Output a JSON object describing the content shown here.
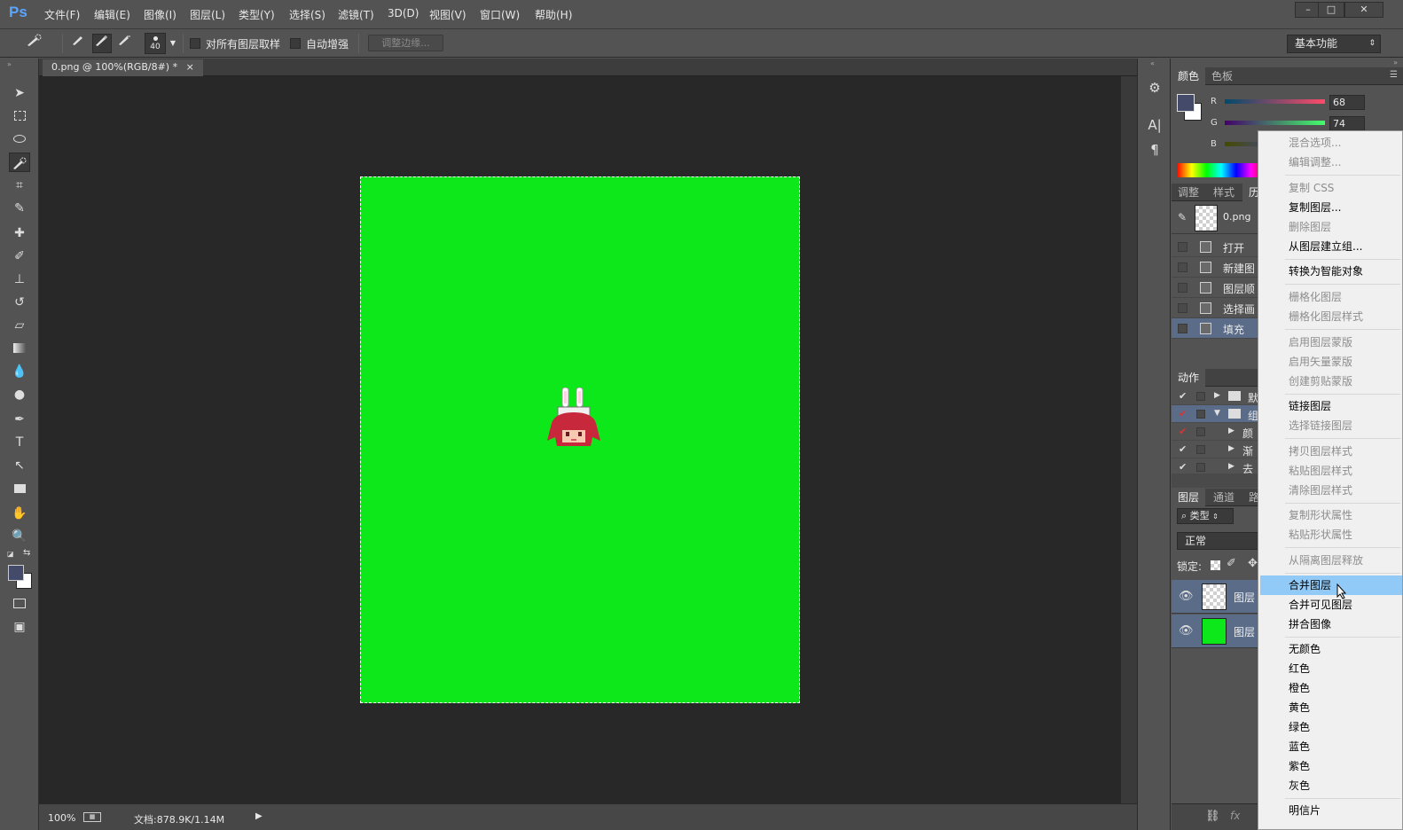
{
  "app": {
    "logo": "Ps"
  },
  "menu": [
    {
      "label": "文件(F)"
    },
    {
      "label": "编辑(E)"
    },
    {
      "label": "图像(I)"
    },
    {
      "label": "图层(L)"
    },
    {
      "label": "类型(Y)"
    },
    {
      "label": "选择(S)"
    },
    {
      "label": "滤镜(T)"
    },
    {
      "label": "3D(D)"
    },
    {
      "label": "视图(V)"
    },
    {
      "label": "窗口(W)"
    },
    {
      "label": "帮助(H)"
    }
  ],
  "window_controls": {
    "minimize": "–",
    "restore": "□",
    "close": "✕"
  },
  "options": {
    "brush_size": "40",
    "sample_all_layers": "对所有图层取样",
    "auto_enhance": "自动增强",
    "refine_edge": "调整边缘...",
    "workspace": "基本功能"
  },
  "document": {
    "tab_title": "0.png @ 100%(RGB/8#) *",
    "tab_close": "×",
    "canvas_color": "#0de81a",
    "zoom": "100%",
    "doc_info": "文档:878.9K/1.14M"
  },
  "color_panel": {
    "tabs": [
      "颜色",
      "色板"
    ],
    "r_label": "R",
    "r_value": "68",
    "g_label": "G",
    "g_value": "74",
    "b_label": "B",
    "fg_color": "#444a6a"
  },
  "history_panel": {
    "tabs": [
      "调整",
      "样式",
      "历"
    ],
    "snapshot": "0.png",
    "items": [
      {
        "label": "打开"
      },
      {
        "label": "新建图"
      },
      {
        "label": "图层顺"
      },
      {
        "label": "选择画"
      },
      {
        "label": "填充"
      }
    ]
  },
  "actions_panel": {
    "tab": "动作",
    "items": [
      {
        "label": "默"
      },
      {
        "label": "组"
      },
      {
        "label": "颜"
      },
      {
        "label": "渐"
      },
      {
        "label": "去"
      }
    ]
  },
  "layers_panel": {
    "tabs": [
      "图层",
      "通道",
      "路"
    ],
    "filter": "类型",
    "blend_mode": "正常",
    "lock_label": "锁定:",
    "layers": [
      {
        "name": "图层",
        "thumb": "transparent"
      },
      {
        "name": "图层",
        "thumb": "#0de81a"
      }
    ]
  },
  "context_menu": {
    "items": [
      {
        "label": "混合选项...",
        "disabled": true
      },
      {
        "label": "编辑调整...",
        "disabled": true
      },
      {
        "label": "复制 CSS",
        "disabled": true
      },
      {
        "label": "复制图层...",
        "disabled": false
      },
      {
        "label": "删除图层",
        "disabled": true
      },
      {
        "label": "从图层建立组...",
        "disabled": false
      },
      {
        "label": "转换为智能对象",
        "disabled": false
      },
      {
        "label": "栅格化图层",
        "disabled": true
      },
      {
        "label": "栅格化图层样式",
        "disabled": true
      },
      {
        "label": "启用图层蒙版",
        "disabled": true
      },
      {
        "label": "启用矢量蒙版",
        "disabled": true
      },
      {
        "label": "创建剪贴蒙版",
        "disabled": true
      },
      {
        "label": "链接图层",
        "disabled": false
      },
      {
        "label": "选择链接图层",
        "disabled": true
      },
      {
        "label": "拷贝图层样式",
        "disabled": true
      },
      {
        "label": "粘贴图层样式",
        "disabled": true
      },
      {
        "label": "清除图层样式",
        "disabled": true
      },
      {
        "label": "复制形状属性",
        "disabled": true
      },
      {
        "label": "粘贴形状属性",
        "disabled": true
      },
      {
        "label": "从隔离图层释放",
        "disabled": true
      },
      {
        "label": "合并图层",
        "disabled": false,
        "highlight": true
      },
      {
        "label": "合并可见图层",
        "disabled": false
      },
      {
        "label": "拼合图像",
        "disabled": false
      },
      {
        "label": "无颜色",
        "disabled": false
      },
      {
        "label": "红色",
        "disabled": false
      },
      {
        "label": "橙色",
        "disabled": false
      },
      {
        "label": "黄色",
        "disabled": false
      },
      {
        "label": "绿色",
        "disabled": false
      },
      {
        "label": "蓝色",
        "disabled": false
      },
      {
        "label": "紫色",
        "disabled": false
      },
      {
        "label": "灰色",
        "disabled": false
      },
      {
        "label": "明信片",
        "disabled": false
      }
    ]
  }
}
